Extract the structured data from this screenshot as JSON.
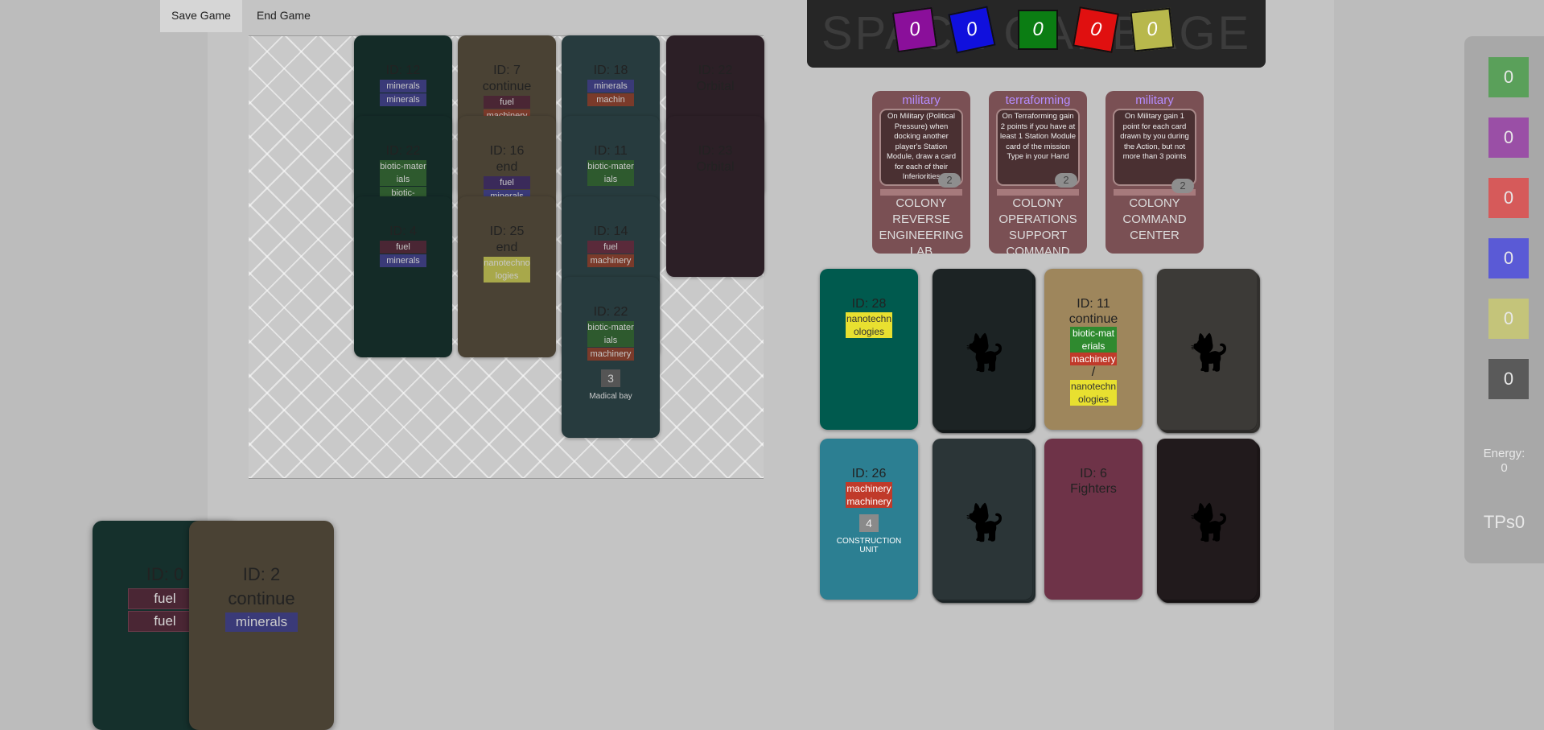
{
  "menu": {
    "save": "Save Game",
    "end": "End Game"
  },
  "scorebar": {
    "title": "SPACE GARBAGE",
    "scores": [
      {
        "value": "0",
        "color": "#8a0f9a"
      },
      {
        "value": "0",
        "color": "#1010dd"
      },
      {
        "value": "0",
        "color": "#0b7d13"
      },
      {
        "value": "0",
        "color": "#e01010"
      },
      {
        "value": "0",
        "color": "#b8b84c"
      }
    ]
  },
  "board": {
    "columns": [
      {
        "cards": [
          {
            "id": "ID: 12",
            "label": "",
            "chips": [
              {
                "t": "minerals",
                "c": "#3a3a78"
              },
              {
                "t": "minerals",
                "c": "#3a3a78"
              }
            ]
          },
          {
            "id": "ID: 22",
            "label": "",
            "chips": [
              {
                "t": "biotic-materials",
                "c": "#2e5a2e"
              },
              {
                "t": "biotic-",
                "c": "#2e5a2e"
              }
            ]
          },
          {
            "id": "ID: 4",
            "label": "",
            "chips": [
              {
                "t": "fuel",
                "c": "#4a2634"
              },
              {
                "t": "minerals",
                "c": "#3a3a78"
              }
            ]
          }
        ]
      },
      {
        "cards": [
          {
            "id": "ID: 7",
            "label": "continue",
            "chips": [
              {
                "t": "fuel",
                "c": "#4a2634"
              },
              {
                "t": "machinery",
                "c": "#7a3a2a"
              }
            ]
          },
          {
            "id": "ID: 16",
            "label": "end",
            "chips": [
              {
                "t": "fuel",
                "c": "#3a2a5a"
              },
              {
                "t": "minerals",
                "c": "#3a3a78"
              }
            ]
          },
          {
            "id": "ID: 25",
            "label": "end",
            "chips": [
              {
                "t": "nanotechnologies",
                "c": "#a8a84a"
              }
            ]
          }
        ]
      },
      {
        "cards": [
          {
            "id": "ID: 18",
            "label": "",
            "chips": [
              {
                "t": "minerals",
                "c": "#3a3a78"
              },
              {
                "t": "machin",
                "c": "#7a3a2a"
              }
            ]
          },
          {
            "id": "ID: 11",
            "label": "",
            "chips": [
              {
                "t": "biotic-materials",
                "c": "#2e5a2e"
              }
            ]
          },
          {
            "id": "ID: 14",
            "label": "",
            "chips": [
              {
                "t": "fuel",
                "c": "#5a2a3a"
              },
              {
                "t": "machinery",
                "c": "#7a3a2a"
              }
            ]
          },
          {
            "id": "ID: 22",
            "label": "",
            "chips": [
              {
                "t": "biotic-materials",
                "c": "#2e5a2e"
              },
              {
                "t": "machinery",
                "c": "#7a3a2a"
              }
            ],
            "cost": "3",
            "name": "Madical bay"
          }
        ]
      },
      {
        "cards": [
          {
            "id": "ID: 22",
            "label": "Orbital",
            "chips": []
          },
          {
            "id": "ID: 23",
            "label": "Orbital",
            "chips": []
          }
        ]
      }
    ]
  },
  "missions": [
    {
      "type": "military",
      "text": "On Military (Political Pressure) when docking another player's Station Module, draw a card for each of their Inferiorities",
      "points": "2",
      "name": "COLONY REVERSE ENGINEERING LAB"
    },
    {
      "type": "terraforming",
      "text": "On Terraforming gain 2 points if you have at least 1 Station Module card of the mission Type in your Hand",
      "points": "2",
      "name": "COLONY OPERATIONS SUPPORT COMMAND"
    },
    {
      "type": "military",
      "text": "On Military gain 1 point for each card drawn by you during the Action, but not more than 3 points",
      "points": "2",
      "name": "COLONY COMMAND CENTER"
    }
  ],
  "market": {
    "c28": {
      "id": "ID: 28",
      "chips": [
        "nanotechnologies"
      ]
    },
    "c11": {
      "id": "ID: 11",
      "label": "continue",
      "chips": [
        "biotic-materials",
        "machinery"
      ],
      "sep": "/",
      "alt": "nanotechnologies"
    },
    "c26": {
      "id": "ID: 26",
      "chips": [
        "machinery",
        "machinery"
      ],
      "cost": "4",
      "name": "CONSTRUCTION UNIT"
    },
    "c6": {
      "id": "ID: 6",
      "label": "Fighters"
    }
  },
  "sidebar": {
    "resources": [
      {
        "value": "0",
        "color": "#5aa05a"
      },
      {
        "value": "0",
        "color": "#9a4fa6"
      },
      {
        "value": "0",
        "color": "#d65a5a"
      },
      {
        "value": "0",
        "color": "#5a5ad6"
      },
      {
        "value": "0",
        "color": "#c4c47a"
      },
      {
        "value": "0",
        "color": "#5a5a5a"
      }
    ],
    "energy_label": "Energy:",
    "energy_value": "0",
    "tps": "TPs0"
  },
  "hand": {
    "c0": {
      "id": "ID: 0",
      "chips": [
        "fuel",
        "fuel"
      ]
    },
    "c2": {
      "id": "ID: 2",
      "label": "continue",
      "chips": [
        "minerals"
      ]
    }
  }
}
